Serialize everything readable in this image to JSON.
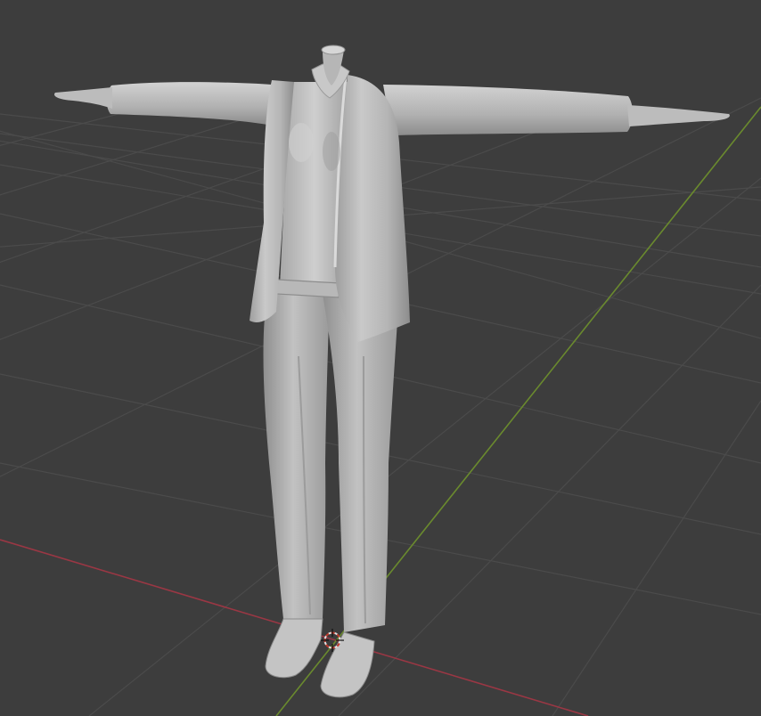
{
  "viewport": {
    "background_color": "#3d3d3d",
    "grid_line_color": "#4b4b4b",
    "x_axis_color": "#9a3744",
    "y_axis_color": "#6a8a2e",
    "model_color": "#bdbdbd",
    "cursor_colors": [
      "#e0e0e0",
      "#c0392b"
    ]
  },
  "scene": {
    "model": "headless-mannequin-in-suit",
    "pose": "t-pose",
    "view": "perspective",
    "grid_visible": true,
    "three_d_cursor_visible": true
  }
}
